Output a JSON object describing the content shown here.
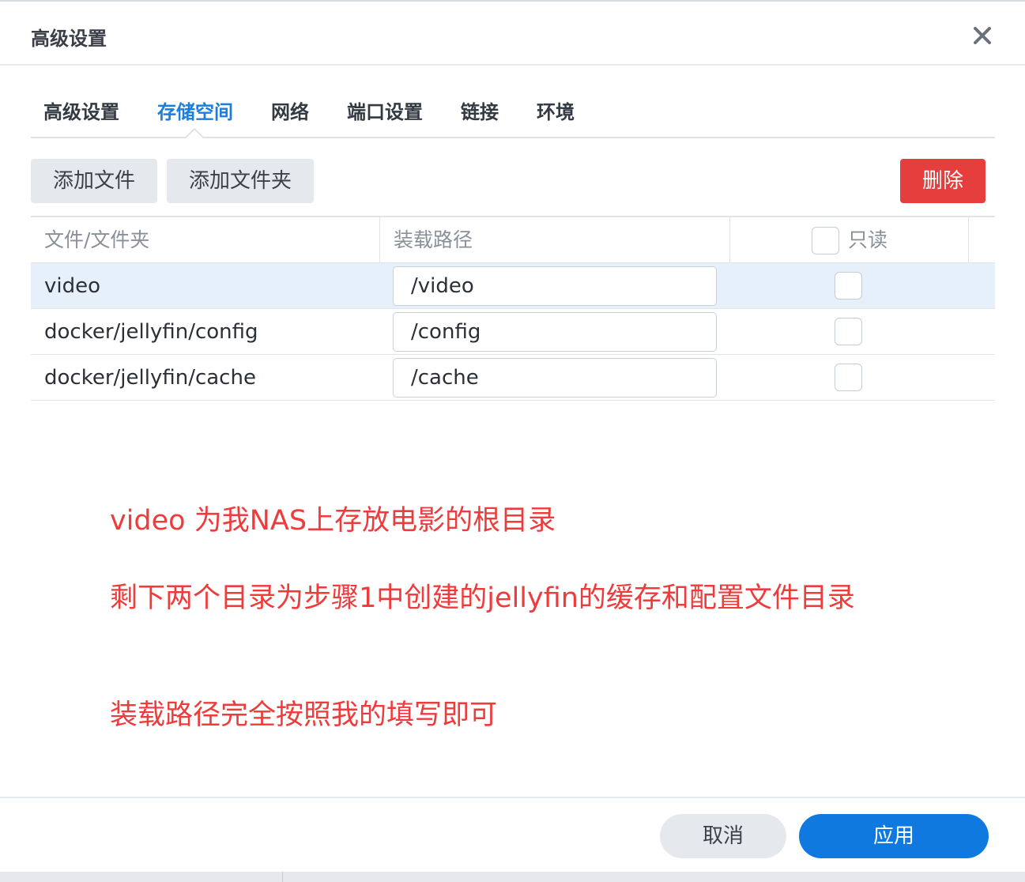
{
  "dialog": {
    "title": "高级设置",
    "close_icon": "close-icon"
  },
  "tabs": [
    {
      "label": "高级设置"
    },
    {
      "label": "存储空间",
      "active": true
    },
    {
      "label": "网络"
    },
    {
      "label": "端口设置"
    },
    {
      "label": "链接"
    },
    {
      "label": "环境"
    }
  ],
  "toolbar": {
    "add_file_label": "添加文件",
    "add_folder_label": "添加文件夹",
    "delete_label": "删除"
  },
  "table": {
    "headers": {
      "file_folder": "文件/文件夹",
      "mount_path": "装载路径",
      "readonly": "只读"
    },
    "rows": [
      {
        "name": "video",
        "mount": "/video",
        "readonly": false,
        "selected": true
      },
      {
        "name": "docker/jellyfin/config",
        "mount": "/config",
        "readonly": false,
        "selected": false
      },
      {
        "name": "docker/jellyfin/cache",
        "mount": "/cache",
        "readonly": false,
        "selected": false
      }
    ]
  },
  "annotations": [
    "video 为我NAS上存放电影的根目录",
    "剩下两个目录为步骤1中创建的jellyfin的缓存和配置文件目录",
    "装载路径完全按照我的填写即可"
  ],
  "footer": {
    "cancel_label": "取消",
    "apply_label": "应用"
  },
  "colors": {
    "accent": "#0f79e0",
    "active_tab": "#1a7de0",
    "danger": "#e63d3d",
    "annotation": "#ee3b3b",
    "selected_row": "#e6f0fb"
  }
}
